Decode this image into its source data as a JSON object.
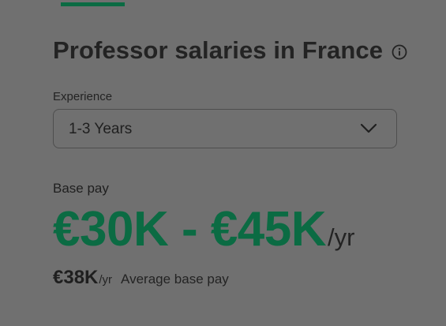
{
  "header": {
    "title": "Professor salaries in France",
    "info_icon": "info-circle-icon"
  },
  "experience": {
    "label": "Experience",
    "selected": "1-3 Years",
    "chevron_icon": "chevron-down-icon"
  },
  "base_pay": {
    "label": "Base pay",
    "range": "€30K - €45K",
    "range_unit": "/yr",
    "average_value": "€38K",
    "average_unit": "/yr",
    "average_label": "Average base pay"
  },
  "colors": {
    "background": "#707070",
    "accent_green": "#0b6b43",
    "text": "#1f1f1f"
  }
}
